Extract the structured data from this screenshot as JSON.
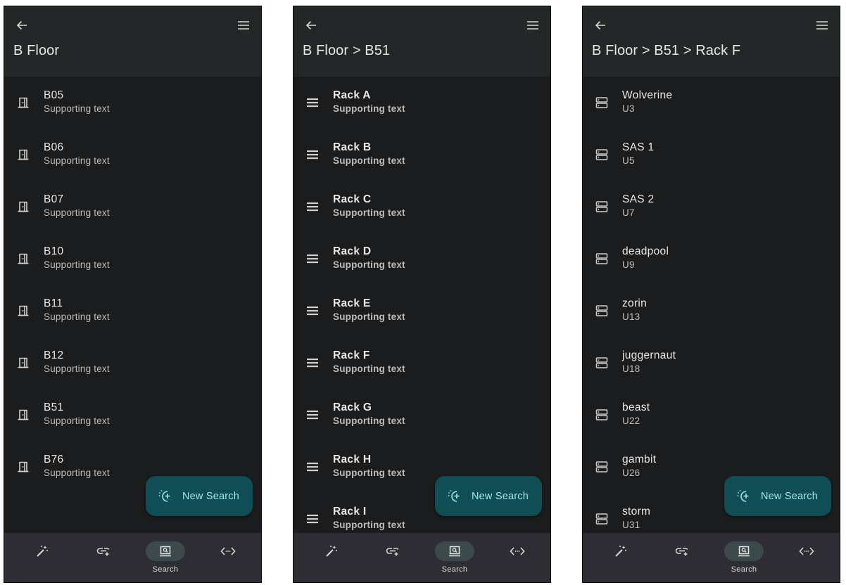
{
  "icon_color": "#cfcfcf",
  "fab_color": "#0e4e54",
  "fab_text_color": "#9fe7ef",
  "screens": [
    {
      "title": "B Floor",
      "item_icon": "door-icon",
      "items": [
        {
          "primary": "B05",
          "secondary": "Supporting text"
        },
        {
          "primary": "B06",
          "secondary": "Supporting text"
        },
        {
          "primary": "B07",
          "secondary": "Supporting text"
        },
        {
          "primary": "B10",
          "secondary": "Supporting text"
        },
        {
          "primary": "B11",
          "secondary": "Supporting text"
        },
        {
          "primary": "B12",
          "secondary": "Supporting text"
        },
        {
          "primary": "B51",
          "secondary": "Supporting text"
        },
        {
          "primary": "B76",
          "secondary": "Supporting text"
        }
      ],
      "fab_label": "New Search",
      "nav": [
        {
          "icon": "magic-wand-icon",
          "label": ""
        },
        {
          "icon": "link-add-icon",
          "label": ""
        },
        {
          "icon": "search-window-icon",
          "label": "Search",
          "active": true
        },
        {
          "icon": "code-arrows-icon",
          "label": ""
        }
      ]
    },
    {
      "title": "B Floor > B51",
      "item_icon": "rack-lines-icon",
      "items": [
        {
          "primary": "Rack A",
          "secondary": "Supporting text"
        },
        {
          "primary": "Rack B",
          "secondary": "Supporting text"
        },
        {
          "primary": "Rack C",
          "secondary": "Supporting text"
        },
        {
          "primary": "Rack D",
          "secondary": "Supporting text"
        },
        {
          "primary": "Rack E",
          "secondary": "Supporting text"
        },
        {
          "primary": "Rack F",
          "secondary": "Supporting text"
        },
        {
          "primary": "Rack G",
          "secondary": "Supporting text"
        },
        {
          "primary": "Rack H",
          "secondary": "Supporting text"
        },
        {
          "primary": "Rack I",
          "secondary": "Supporting text"
        }
      ],
      "fab_label": "New Search",
      "nav": [
        {
          "icon": "magic-wand-icon",
          "label": ""
        },
        {
          "icon": "link-add-icon",
          "label": ""
        },
        {
          "icon": "search-window-icon",
          "label": "Search",
          "active": true
        },
        {
          "icon": "code-arrows-icon",
          "label": ""
        }
      ]
    },
    {
      "title": "B Floor > B51 > Rack F",
      "item_icon": "server-icon",
      "items": [
        {
          "primary": "Wolverine",
          "secondary": "U3"
        },
        {
          "primary": "SAS 1",
          "secondary": "U5"
        },
        {
          "primary": "SAS 2",
          "secondary": "U7"
        },
        {
          "primary": "deadpool",
          "secondary": "U9"
        },
        {
          "primary": "zorin",
          "secondary": "U13"
        },
        {
          "primary": "juggernaut",
          "secondary": "U18"
        },
        {
          "primary": "beast",
          "secondary": "U22"
        },
        {
          "primary": "gambit",
          "secondary": "U26"
        },
        {
          "primary": "storm",
          "secondary": "U31"
        }
      ],
      "fab_label": "New Search",
      "nav": [
        {
          "icon": "magic-wand-icon",
          "label": ""
        },
        {
          "icon": "link-add-icon",
          "label": ""
        },
        {
          "icon": "search-window-icon",
          "label": "Search",
          "active": true
        },
        {
          "icon": "code-arrows-icon",
          "label": ""
        }
      ]
    }
  ]
}
